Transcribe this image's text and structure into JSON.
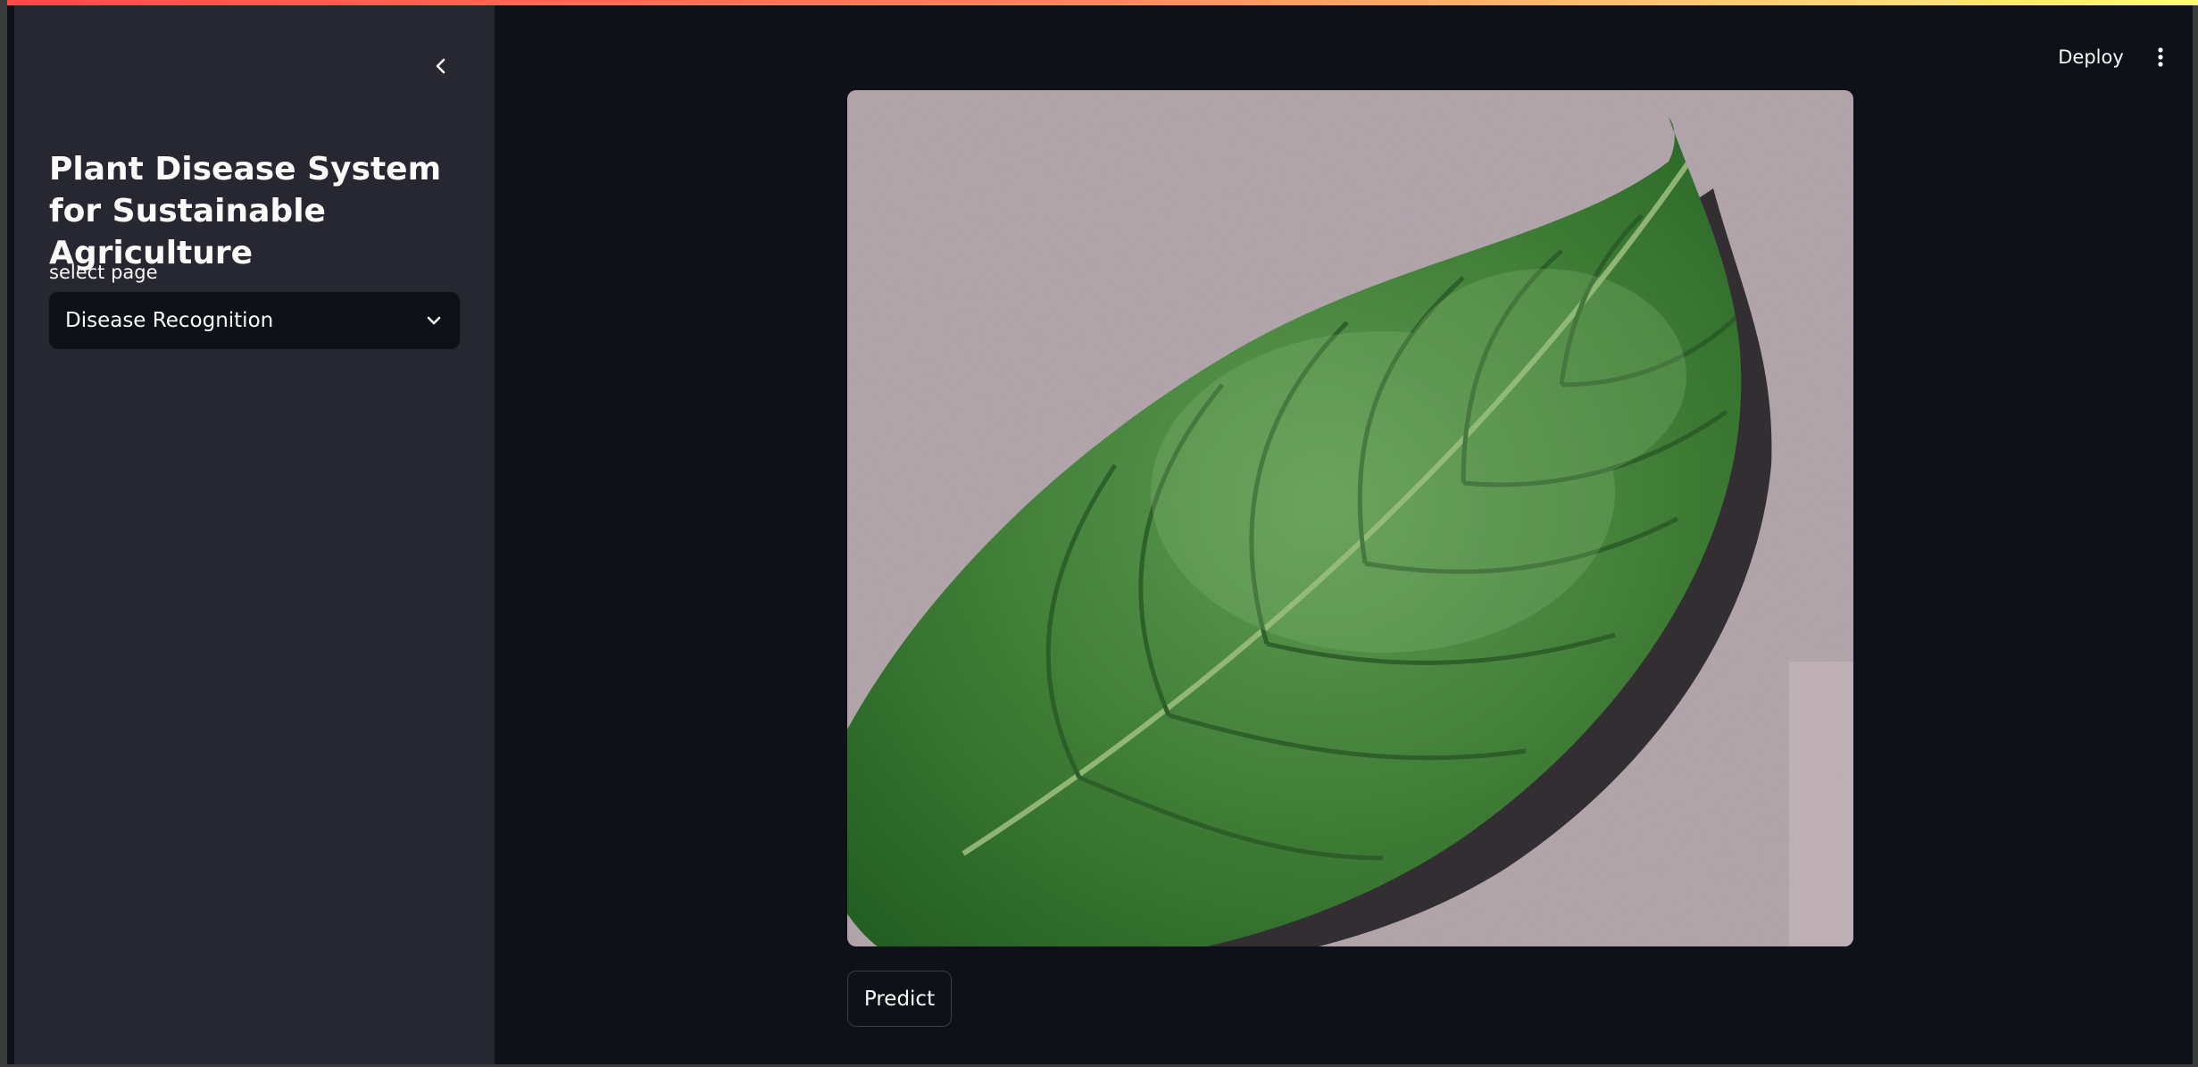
{
  "sidebar": {
    "title": "Plant Disease System for Sustainable Agriculture",
    "select_label": "select page",
    "select_value": "Disease Recognition"
  },
  "header": {
    "deploy_label": "Deploy"
  },
  "main": {
    "predict_label": "Predict"
  },
  "icons": {
    "collapse": "chevron-left-icon",
    "dropdown": "chevron-down-icon",
    "menu": "more-vertical-icon"
  },
  "colors": {
    "app_bg": "#0e1117",
    "sidebar_bg": "#262730",
    "text": "#fafafa",
    "accent_start": "#ff4b4b",
    "accent_end": "#fffd80"
  }
}
